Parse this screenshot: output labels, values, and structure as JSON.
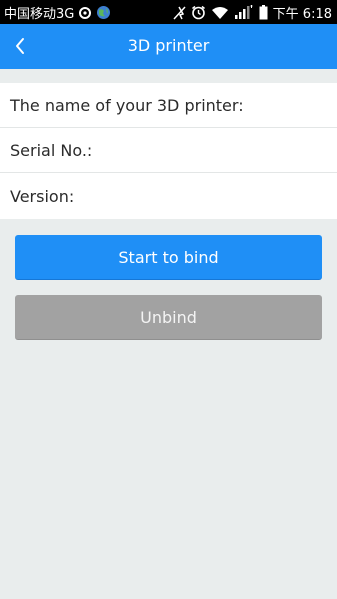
{
  "status_bar": {
    "carrier": "中国移动3G",
    "time": "下午 6:18",
    "icons": [
      "settings-notification-icon",
      "globe-icon",
      "mute-icon",
      "alarm-icon",
      "wifi-icon",
      "signal-icon",
      "battery-icon"
    ]
  },
  "header": {
    "title": "3D printer",
    "back_icon": "chevron-left-icon"
  },
  "info": {
    "printer_name_label": "The name of your 3D printer:",
    "serial_label": "Serial No.:",
    "version_label": "Version:"
  },
  "actions": {
    "bind_label": "Start to bind",
    "unbind_label": "Unbind"
  },
  "colors": {
    "primary": "#1f8ff6",
    "disabled": "#a2a2a2",
    "background": "#e9eded"
  }
}
